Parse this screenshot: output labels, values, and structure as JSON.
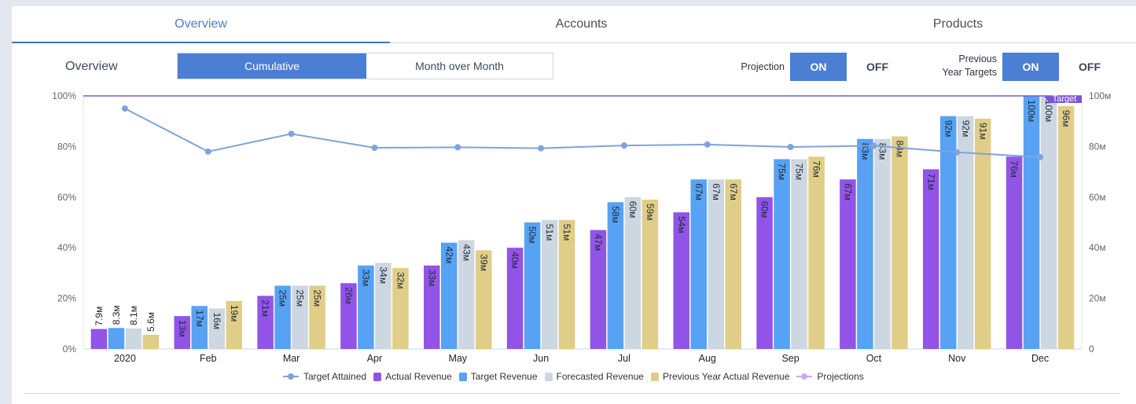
{
  "tabs": [
    {
      "label": "Overview",
      "active": true
    },
    {
      "label": "Accounts",
      "active": false
    },
    {
      "label": "Products",
      "active": false
    }
  ],
  "controls": {
    "section_label": "Overview",
    "view_modes": [
      {
        "label": "Cumulative",
        "active": true
      },
      {
        "label": "Month over Month",
        "active": false
      }
    ],
    "projection": {
      "label": "Projection",
      "on_label": "ON",
      "off_label": "OFF",
      "value": "ON"
    },
    "previous_year_targets": {
      "label_line1": "Previous",
      "label_line2": "Year Targets",
      "on_label": "ON",
      "off_label": "OFF",
      "value": "ON"
    }
  },
  "colors": {
    "accent": "#4a7fd3",
    "actual": "#9254e6",
    "target": "#57a2f2",
    "forecast": "#cdd7e1",
    "prev_year": "#e0cd87",
    "attained_line": "#7fa3da",
    "projection_line": "#b894ee",
    "target_line": "#7b55d9"
  },
  "chart_data": {
    "type": "bar",
    "title": "",
    "categories": [
      "2020",
      "Feb",
      "Mar",
      "Apr",
      "May",
      "Jun",
      "Jul",
      "Aug",
      "Sep",
      "Oct",
      "Nov",
      "Dec"
    ],
    "series": [
      {
        "name": "Actual Revenue",
        "key": "actual",
        "axis": "right",
        "values": [
          7.9,
          13,
          21,
          26,
          33,
          40,
          47,
          54,
          60,
          67,
          71,
          76
        ],
        "labels": [
          "7.9м",
          "13м",
          "21м",
          "26м",
          "33м",
          "40м",
          "47м",
          "54м",
          "60м",
          "67м",
          "71м",
          "76м"
        ]
      },
      {
        "name": "Target Revenue",
        "key": "target",
        "axis": "right",
        "values": [
          8.3,
          17,
          25,
          33,
          42,
          50,
          58,
          67,
          75,
          83,
          92,
          100
        ],
        "labels": [
          "8.3м",
          "17м",
          "25м",
          "33м",
          "42м",
          "50м",
          "58м",
          "67м",
          "75м",
          "83м",
          "92м",
          "100м"
        ]
      },
      {
        "name": "Forecasted Revenue",
        "key": "forecast",
        "axis": "right",
        "values": [
          8.1,
          16,
          25,
          34,
          43,
          51,
          60,
          67,
          75,
          83,
          92,
          100
        ],
        "labels": [
          "8.1м",
          "16м",
          "25м",
          "34м",
          "43м",
          "51м",
          "60м",
          "67м",
          "75м",
          "83м",
          "92м",
          "100м"
        ]
      },
      {
        "name": "Previous Year Actual Revenue",
        "key": "prev_year",
        "axis": "right",
        "values": [
          5.6,
          19,
          25,
          32,
          39,
          51,
          59,
          67,
          76,
          84,
          91,
          96
        ],
        "labels": [
          "5.6м",
          "19м",
          "25м",
          "32м",
          "39м",
          "51м",
          "59м",
          "67м",
          "76м",
          "84м",
          "91м",
          "96м"
        ]
      },
      {
        "name": "Target Attained",
        "key": "attained",
        "type": "line",
        "axis": "left",
        "values": [
          95,
          78,
          85,
          79.5,
          79.7,
          79.3,
          80.4,
          80.8,
          79.8,
          80.3,
          77.7,
          75.8
        ]
      }
    ],
    "legend": [
      "Target Attained",
      "Actual Revenue",
      "Target Revenue",
      "Forecasted Revenue",
      "Previous Year Actual Revenue",
      "Projections"
    ],
    "legend_position": "bottom",
    "target_line": {
      "label": "Target",
      "value": 100
    },
    "y_left": {
      "ticks": [
        "0%",
        "20%",
        "40%",
        "60%",
        "80%",
        "100%"
      ],
      "range": [
        0,
        100
      ],
      "unit": "%"
    },
    "y_right": {
      "ticks": [
        "0",
        "20м",
        "40м",
        "60м",
        "80м",
        "100м"
      ],
      "range": [
        0,
        100
      ],
      "unit": "M"
    },
    "xlabel": "",
    "ylabel": "",
    "grid": false
  }
}
